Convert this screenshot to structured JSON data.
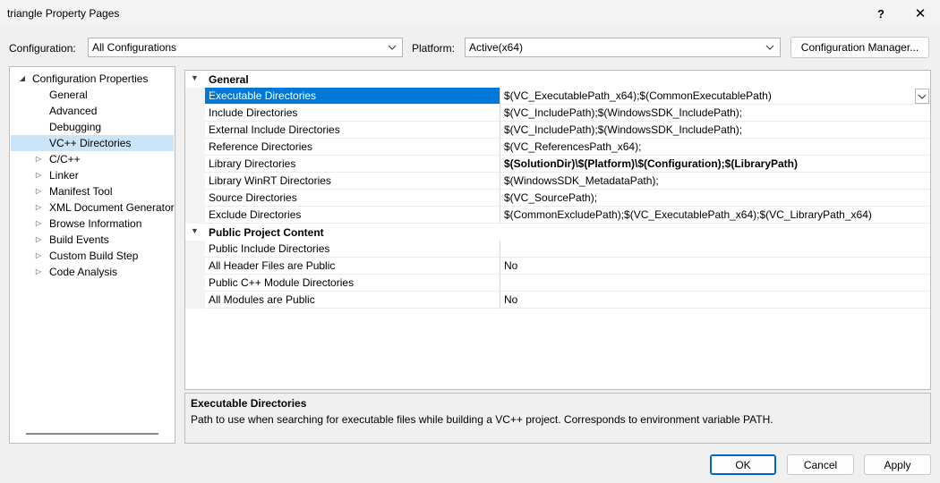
{
  "window": {
    "title": "triangle Property Pages",
    "help_label": "?",
    "close_label": "✕"
  },
  "toolbar": {
    "configuration_label": "Configuration:",
    "configuration_value": "All Configurations",
    "platform_label": "Platform:",
    "platform_value": "Active(x64)",
    "config_manager_label": "Configuration Manager..."
  },
  "tree": {
    "root": "Configuration Properties",
    "items": [
      {
        "label": "General",
        "expandable": false
      },
      {
        "label": "Advanced",
        "expandable": false
      },
      {
        "label": "Debugging",
        "expandable": false
      },
      {
        "label": "VC++ Directories",
        "expandable": false,
        "selected": true
      },
      {
        "label": "C/C++",
        "expandable": true
      },
      {
        "label": "Linker",
        "expandable": true
      },
      {
        "label": "Manifest Tool",
        "expandable": true
      },
      {
        "label": "XML Document Generator",
        "expandable": true
      },
      {
        "label": "Browse Information",
        "expandable": true
      },
      {
        "label": "Build Events",
        "expandable": true
      },
      {
        "label": "Custom Build Step",
        "expandable": true
      },
      {
        "label": "Code Analysis",
        "expandable": true
      }
    ]
  },
  "grid": {
    "categories": [
      {
        "name": "General",
        "rows": [
          {
            "name": "Executable Directories",
            "value": "$(VC_ExecutablePath_x64);$(CommonExecutablePath)",
            "selected": true
          },
          {
            "name": "Include Directories",
            "value": "$(VC_IncludePath);$(WindowsSDK_IncludePath);"
          },
          {
            "name": "External Include Directories",
            "value": "$(VC_IncludePath);$(WindowsSDK_IncludePath);"
          },
          {
            "name": "Reference Directories",
            "value": "$(VC_ReferencesPath_x64);"
          },
          {
            "name": "Library Directories",
            "value": "$(SolutionDir)\\$(Platform)\\$(Configuration);$(LibraryPath)",
            "bold": true
          },
          {
            "name": "Library WinRT Directories",
            "value": "$(WindowsSDK_MetadataPath);"
          },
          {
            "name": "Source Directories",
            "value": "$(VC_SourcePath);"
          },
          {
            "name": "Exclude Directories",
            "value": "$(CommonExcludePath);$(VC_ExecutablePath_x64);$(VC_LibraryPath_x64)"
          }
        ]
      },
      {
        "name": "Public Project Content",
        "rows": [
          {
            "name": "Public Include Directories",
            "value": ""
          },
          {
            "name": "All Header Files are Public",
            "value": "No"
          },
          {
            "name": "Public C++ Module Directories",
            "value": ""
          },
          {
            "name": "All Modules are Public",
            "value": "No"
          }
        ]
      }
    ]
  },
  "description": {
    "title": "Executable Directories",
    "text": "Path to use when searching for executable files while building a VC++ project.  Corresponds to environment variable PATH."
  },
  "buttons": {
    "ok": "OK",
    "cancel": "Cancel",
    "apply": "Apply"
  },
  "colors": {
    "selection": "#0078d7",
    "tree_selection": "#cce4f7",
    "focus_border": "#0067c0"
  }
}
